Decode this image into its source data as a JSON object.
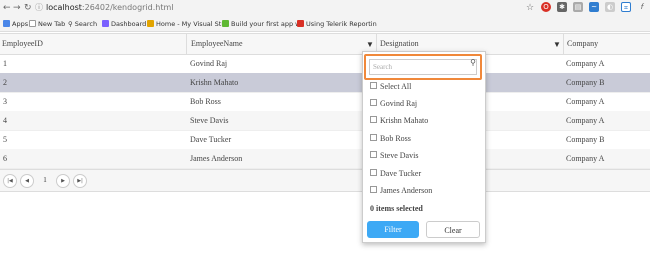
{
  "browser": {
    "url_host": "localhost",
    "url_path": ":26402/kendogrid.html"
  },
  "bookmarks": [
    {
      "label": "Apps",
      "color": "#4a86e8"
    },
    {
      "label": "New Tab",
      "color": "#9e9e9e"
    },
    {
      "label": "Search",
      "color": "#9e9e9e"
    },
    {
      "label": "Dashboard",
      "color": "#7b61ff"
    },
    {
      "label": "Home - My Visual Stu",
      "color": "#e2a400"
    },
    {
      "label": "Build your first app w",
      "color": "#5fb833"
    },
    {
      "label": "Using Telerik Reportin",
      "color": "#d93025"
    }
  ],
  "grid": {
    "columns": [
      "EmployeeID",
      "EmployeeName",
      "Designation",
      "Company"
    ],
    "rows": [
      {
        "id": "1",
        "name": "Govind Raj",
        "company": "Company A"
      },
      {
        "id": "2",
        "name": "Krishn Mahato",
        "company": "Company B"
      },
      {
        "id": "3",
        "name": "Bob Ross",
        "company": "Company A"
      },
      {
        "id": "4",
        "name": "Steve Davis",
        "company": "Company A"
      },
      {
        "id": "5",
        "name": "Dave Tucker",
        "company": "Company B"
      },
      {
        "id": "6",
        "name": "James Anderson",
        "company": "Company A"
      }
    ],
    "selected_row": 1
  },
  "pager": {
    "page": "1",
    "first_icon": "first-page-icon",
    "prev_icon": "previous-page-icon",
    "next_icon": "next-page-icon",
    "last_icon": "last-page-icon"
  },
  "filter_menu": {
    "search_placeholder": "Search",
    "options": [
      "Select All",
      "Govind Raj",
      "Krishn Mahato",
      "Bob Ross",
      "Steve Davis",
      "Dave Tucker",
      "James Anderson"
    ],
    "count_text": "0 items selected",
    "filter_label": "Filter",
    "clear_label": "Clear"
  }
}
